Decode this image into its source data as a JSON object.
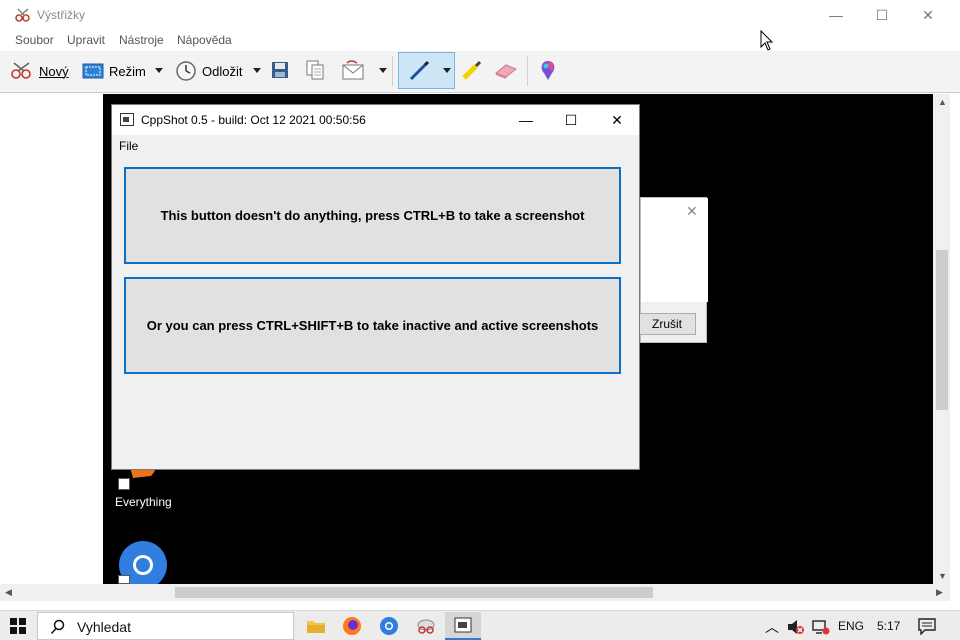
{
  "window": {
    "title": "Výstřižky",
    "controls": {
      "minimize": "—",
      "maximize": "☐",
      "close": "✕"
    }
  },
  "menu": [
    "Soubor",
    "Upravit",
    "Nástroje",
    "Nápověda"
  ],
  "toolbar": {
    "new_label": "Nový",
    "mode_label": "Režim",
    "delay_label": "Odložit"
  },
  "cppshot": {
    "title": "CppShot 0.5 - build: Oct 12 2021 00:50:56",
    "menu_file": "File",
    "button1_label": "This button doesn't do anything, press CTRL+B to take a screenshot",
    "button2_label": "Or you can press CTRL+SHIFT+B to take inactive and active screenshots"
  },
  "background_dialog": {
    "cancel_label": "Zrušit"
  },
  "desktop": {
    "icon_everything_label": "Everything"
  },
  "taskbar": {
    "search_placeholder": "Vyhledat",
    "language": "ENG",
    "time": "5:17"
  },
  "colors": {
    "accent_blue": "#0a6fc8",
    "pen_highlight": "#cde6f7",
    "desktop_bg": "#000000"
  }
}
